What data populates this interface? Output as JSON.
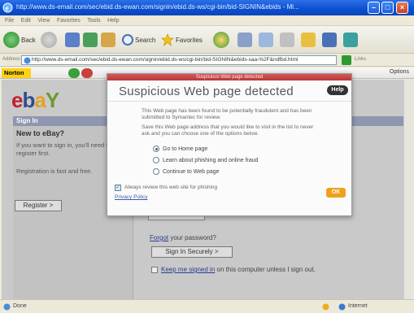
{
  "window": {
    "title": "http://www.ds-email.com/sec/ebid.ds-ewan.com/signin/ebid.ds-ws/cgi-bin/bid-SIGNIN&ebids - Mi...",
    "min": "–",
    "max": "□",
    "close": "×"
  },
  "menu": [
    "File",
    "Edit",
    "View",
    "Favorites",
    "Tools",
    "Help"
  ],
  "toolbar": {
    "back": "Back",
    "search": "Search",
    "favorites": "Favorites"
  },
  "address": {
    "label": "Address",
    "url": "http://www.ds-email.com/sec/ebid.ds-ewan.com/signin/ebid.ds-ws/cgi-bin/bid-SIGNIN&ebids-saa-%2F&ndfbd.html",
    "go": "Go",
    "links": "Links"
  },
  "norton": {
    "logo": "Norton",
    "options": "Options"
  },
  "page": {
    "signin_bar": "Sign In",
    "left_heading": "New to eBay?",
    "left_text": "If you want to sign in, you'll need to register first.",
    "left_text2": "Registration is fast and free.",
    "register": "Register >",
    "forgot_link": "Forgot",
    "forgot_rest": "your password?",
    "signin_button": "Sign In Securely >",
    "keep_signed": "Keep me signed in",
    "keep_rest": "on this computer unless I sign out."
  },
  "dialog": {
    "caption": "Suspicious Web page detected",
    "title": "Suspicious Web page detected",
    "help": "Help",
    "message1": "This Web page has been found to be potentially fraudulent and has been submitted to Symantec for review.",
    "message2": "Save this Web page address that you would like to visit in the list to never ask and you can choose one of the options below.",
    "options": [
      {
        "label": "Go to Home page",
        "selected": true
      },
      {
        "label": "Learn about phishing and online fraud",
        "selected": false
      },
      {
        "label": "Continue to Web page",
        "selected": false
      }
    ],
    "check_label": "Always review this web site for phishing",
    "privacy": "Privacy Policy",
    "ok": "OK"
  },
  "status": {
    "text": "Done",
    "zone": "Internet"
  },
  "colors": {
    "titlebar": "#0a4fd0",
    "dialog_accent": "#b63838",
    "ok": "#f0a020",
    "norton": "#fcd116",
    "ebay_e": "#c1222f",
    "ebay_b": "#2e4c8e",
    "ebay_a": "#e5a221",
    "ebay_y": "#6d9a2f"
  }
}
